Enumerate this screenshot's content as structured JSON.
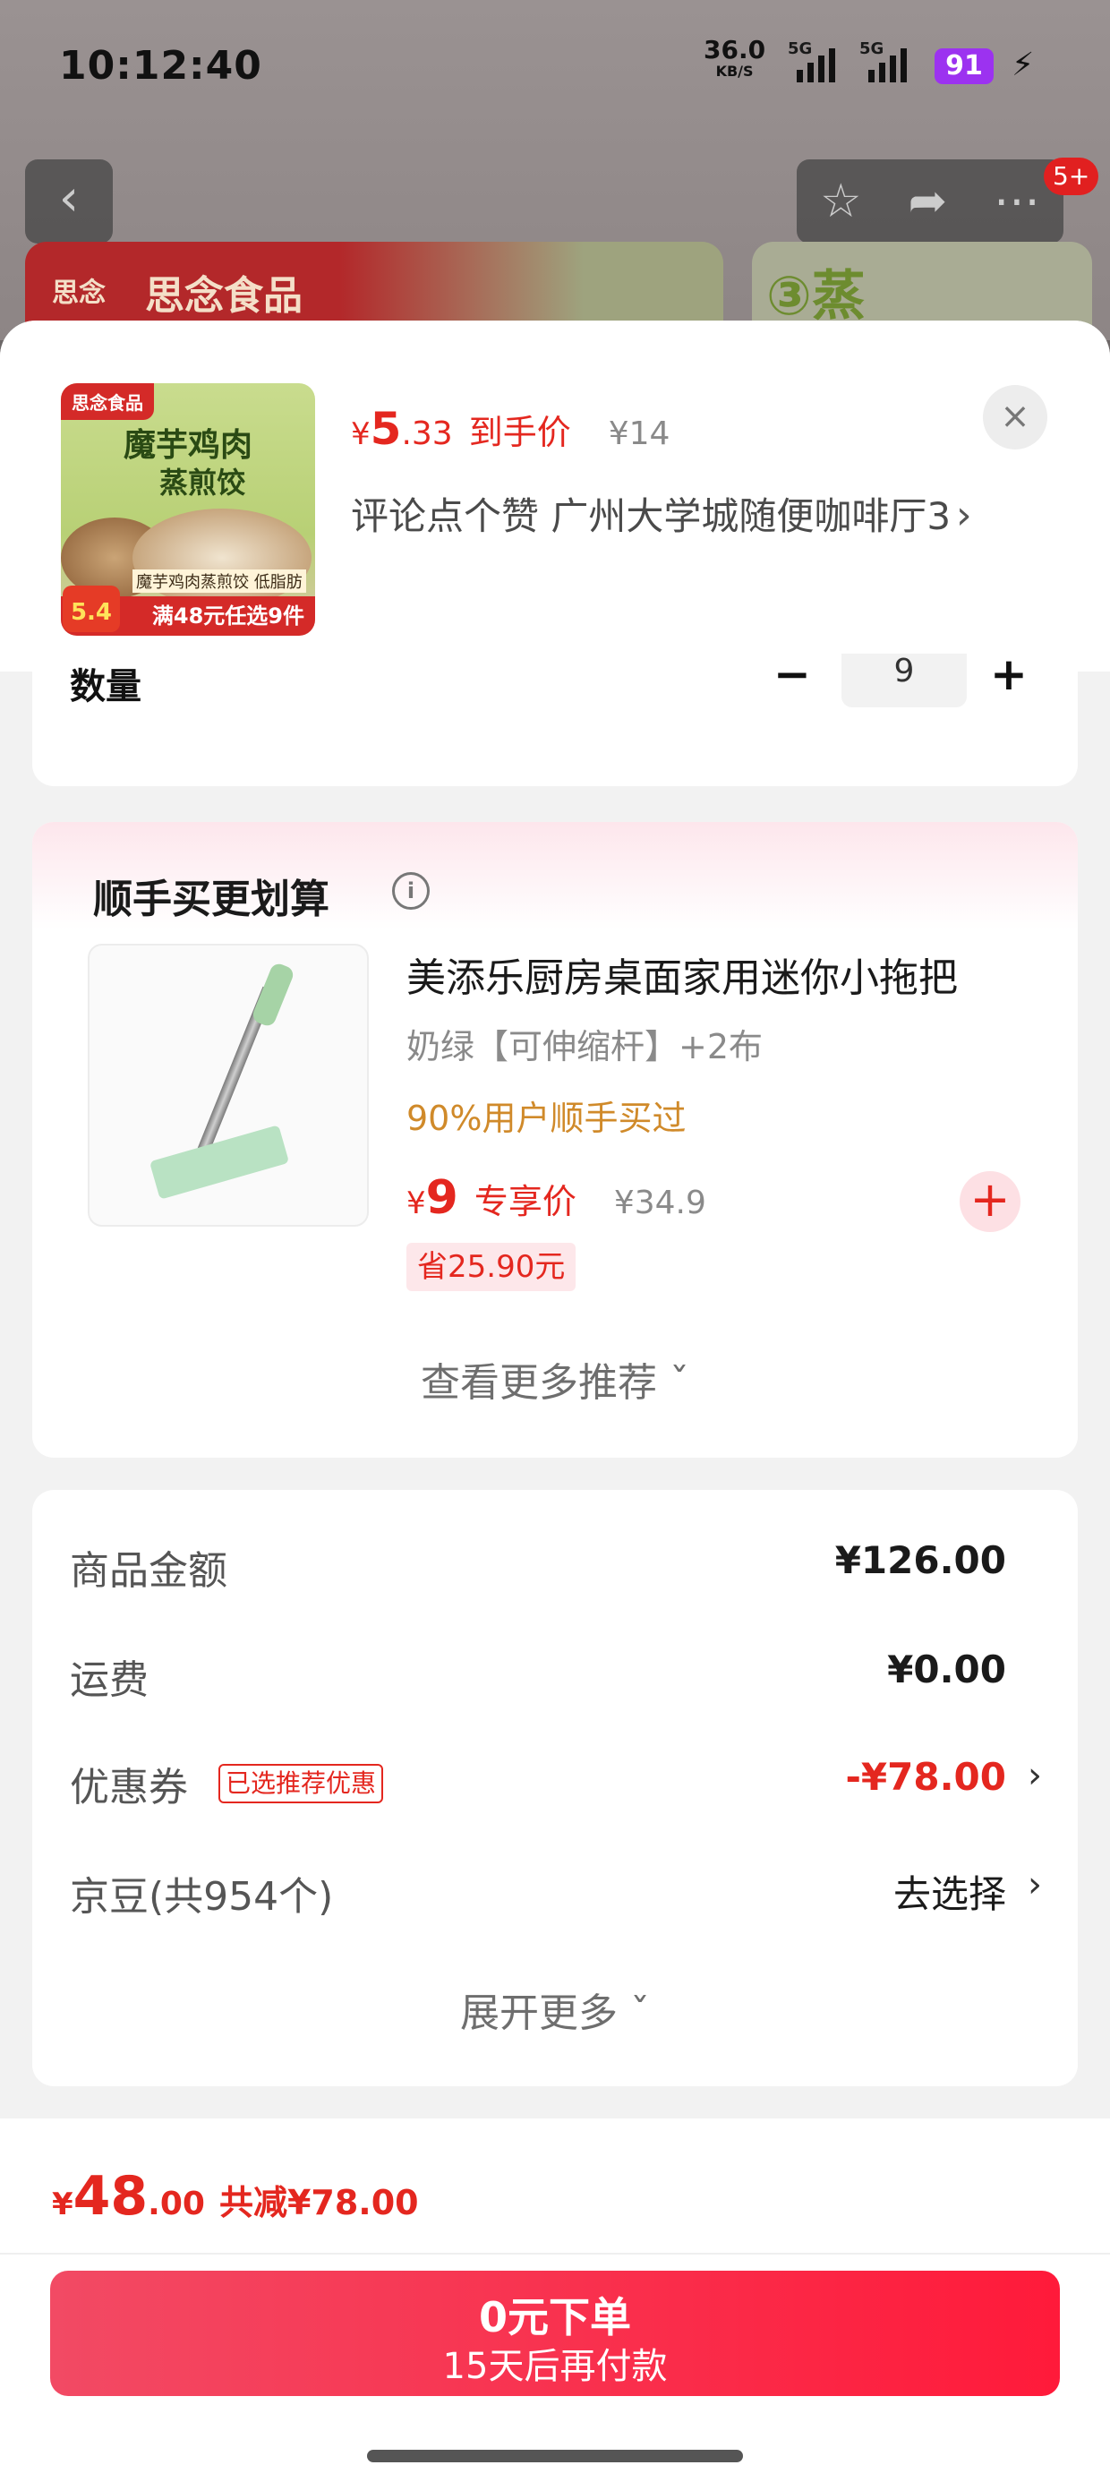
{
  "status_bar": {
    "time": "10:12:40",
    "net_speed": "36.0",
    "net_unit": "KB/S",
    "sim1": "5G",
    "sim2": "5G",
    "battery": "91"
  },
  "background_page": {
    "back_icon": "chevron-left-icon",
    "actions": [
      "star-icon",
      "share-icon",
      "more-icon"
    ],
    "cart_badge": "5+",
    "banner_text": "思念食品",
    "banner_logo": "思念",
    "side_card_text": "③蒸"
  },
  "product_header": {
    "thumb": {
      "brand": "思念食品",
      "line1": "魔芋鸡肉",
      "line2": "蒸煎饺",
      "sub": "魔芋鸡肉蒸煎饺  低脂肪",
      "promo": "满48元任选9件",
      "price_badge": "5.4"
    },
    "currency": "¥",
    "price_int": "5",
    "price_dec": ".33",
    "price_label": "到手价",
    "orig_price": "¥14",
    "spec": "评论点个赞  广州大学城随便咖啡厅3",
    "close_label": "×"
  },
  "quantity": {
    "label": "数量",
    "minus": "−",
    "value": "9",
    "plus": "+"
  },
  "recommend": {
    "title": "顺手买更划算",
    "info": "i",
    "item": {
      "name": "美添乐厨房桌面家用迷你小拖把",
      "spec": "奶绿【可伸缩杆】+2布",
      "social": "90%用户顺手买过",
      "currency": "¥",
      "price": "9",
      "price_label": "专享价",
      "orig_price": "¥34.9",
      "save": "省25.90元",
      "add": "+"
    },
    "more": "查看更多推荐 ˇ"
  },
  "summary": {
    "rows": [
      {
        "label": "商品金额",
        "value": "¥126.00"
      },
      {
        "label": "运费",
        "value": "¥0.00"
      },
      {
        "label": "优惠券",
        "tag": "已选推荐优惠",
        "value": "-¥78.00"
      },
      {
        "label": "京豆(共954个)",
        "value": "去选择"
      }
    ],
    "expand": "展开更多 ˇ"
  },
  "footer": {
    "currency": "¥",
    "total_int": "48",
    "total_dec": ".00",
    "discount": "共减¥78.00",
    "button_main": "0元下单",
    "button_sub": "15天后再付款"
  },
  "colors": {
    "accent_red": "#e4271f",
    "social_orange": "#d08a2a",
    "battery_purple": "#9c32f0"
  }
}
